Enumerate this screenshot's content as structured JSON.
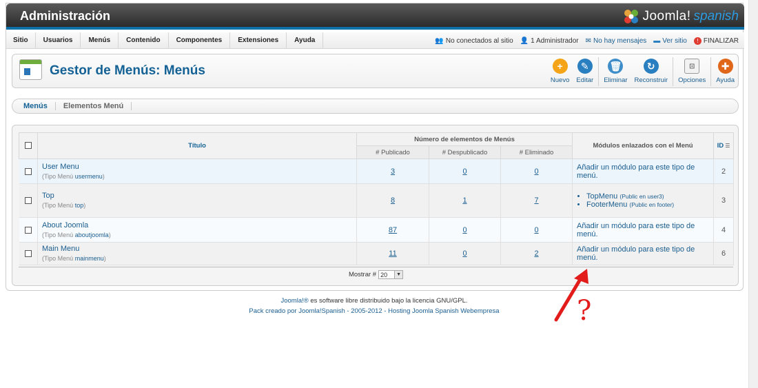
{
  "header": {
    "title": "Administración",
    "logo_text": "Joomla!",
    "logo_sub": "spanish"
  },
  "menubar": {
    "items": [
      "Sitio",
      "Usuarios",
      "Menús",
      "Contenido",
      "Componentes",
      "Extensiones",
      "Ayuda"
    ],
    "status": {
      "not_connected": "No conectados al sitio",
      "admins": "1 Administrador",
      "messages": "No hay mensajes",
      "view_site": "Ver sitio",
      "logout": "FINALIZAR"
    }
  },
  "toolbar": {
    "page_title": "Gestor de Menús: Menús",
    "buttons": [
      {
        "label": "Nuevo",
        "icon": "plus-icon",
        "color": "#f4a416"
      },
      {
        "label": "Editar",
        "icon": "pencil-icon",
        "color": "#2a7fc1"
      },
      {
        "label": "Eliminar",
        "icon": "trash-icon",
        "color": "#3f8ec9"
      },
      {
        "label": "Reconstruir",
        "icon": "refresh-icon",
        "color": "#2a7fc1"
      },
      {
        "label": "Opciones",
        "icon": "options-icon",
        "color": "#999999"
      },
      {
        "label": "Ayuda",
        "icon": "lifebuoy-icon",
        "color": "#e0661a"
      }
    ]
  },
  "subtabs": [
    "Menús",
    "Elementos Menú"
  ],
  "table": {
    "headers": {
      "title": "Título",
      "group": "Número de elementos de Menús",
      "published": "# Publicado",
      "unpublished": "# Despublicado",
      "trashed": "# Eliminado",
      "modules": "Módulos enlazados con el Menú",
      "id": "ID"
    },
    "type_label": "Tipo Menú",
    "rows": [
      {
        "title": "User Menu",
        "type": "usermenu",
        "published": "3",
        "unpublished": "0",
        "trashed": "0",
        "modules_text": "Añadir un módulo para este tipo de menú.",
        "modules": [],
        "id": "2"
      },
      {
        "title": "Top",
        "type": "top",
        "published": "8",
        "unpublished": "1",
        "trashed": "7",
        "modules_text": "",
        "modules": [
          {
            "name": "TopMenu",
            "note": "(Public en user3)"
          },
          {
            "name": "FooterMenu",
            "note": "(Public en footer)"
          }
        ],
        "id": "3"
      },
      {
        "title": "About Joomla",
        "type": "aboutjoomla",
        "published": "87",
        "unpublished": "0",
        "trashed": "0",
        "modules_text": "Añadir un módulo para este tipo de menú.",
        "modules": [],
        "id": "4"
      },
      {
        "title": "Main Menu",
        "type": "mainmenu",
        "published": "11",
        "unpublished": "0",
        "trashed": "2",
        "modules_text": "Añadir un módulo para este tipo de menú.",
        "modules": [],
        "id": "6"
      }
    ],
    "show_label": "Mostrar #",
    "show_value": "20"
  },
  "footer": {
    "line1_link": "Joomla!®",
    "line1_text": " es software libre distribuido bajo la licencia GNU/GPL.",
    "line2": "Pack creado por Joomla!Spanish - 2005-2012 - Hosting Joomla Spanish Webempresa"
  },
  "annotation": {
    "symbol": "?",
    "color": "#e21b1b"
  }
}
